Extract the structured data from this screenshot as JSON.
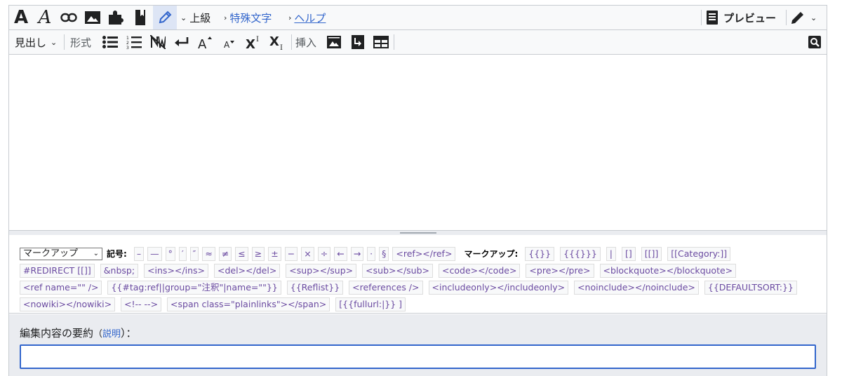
{
  "toolbar_main": {
    "bold": "A",
    "italic": "A",
    "icons": [
      "bold-icon",
      "italic-icon",
      "link-icon",
      "image-icon",
      "puzzle-icon",
      "bookmark-icon",
      "pencil-icon"
    ],
    "advanced": "上級",
    "special_chars": "特殊文字",
    "help": "ヘルプ",
    "preview": "プレビュー"
  },
  "toolbar_sub": {
    "heading": "見出し",
    "format": "形式",
    "insert": "挿入"
  },
  "charinsert": {
    "select_value": "マークアップ",
    "symbols_label": "記号:",
    "symbols": [
      "–",
      "—",
      "°",
      "′",
      "″",
      "≈",
      "≠",
      "≤",
      "≥",
      "±",
      "−",
      "×",
      "÷",
      "←",
      "→",
      "·",
      "§"
    ],
    "ref_chip": "<ref></ref>",
    "markup_label": "マークアップ:",
    "row1_markup": [
      "{{}}",
      "{{{}}}",
      "|",
      "[]",
      "[[]]",
      "[[Category:]]"
    ],
    "row2": [
      "#REDIRECT [[]]",
      "&nbsp;",
      "<ins></ins>",
      "<del></del>",
      "<sup></sup>",
      "<sub></sub>",
      "<code></code>",
      "<pre></pre>",
      "<blockquote></blockquote>"
    ],
    "row3": [
      "<ref name=\"\" />",
      "{{#tag:ref||group=\"注釈\"|name=\"\"}}",
      "{{Reflist}}",
      "<references />",
      "<includeonly></includeonly>",
      "<noinclude></noinclude>",
      "{{DEFAULTSORT:}}"
    ],
    "row4": [
      "<nowiki></nowiki>",
      "<!-- -->",
      "<span class=\"plainlinks\"></span>",
      "[{{fullurl:|}} ]"
    ]
  },
  "summary": {
    "label": "編集内容の要約",
    "open_paren": "（",
    "explain_link": "説明",
    "close_paren": "）：",
    "input_value": ""
  },
  "colors": {
    "accent": "#3366cc",
    "chip_text": "#6b4ba1",
    "toolbar_bg": "#f8f9fa"
  }
}
